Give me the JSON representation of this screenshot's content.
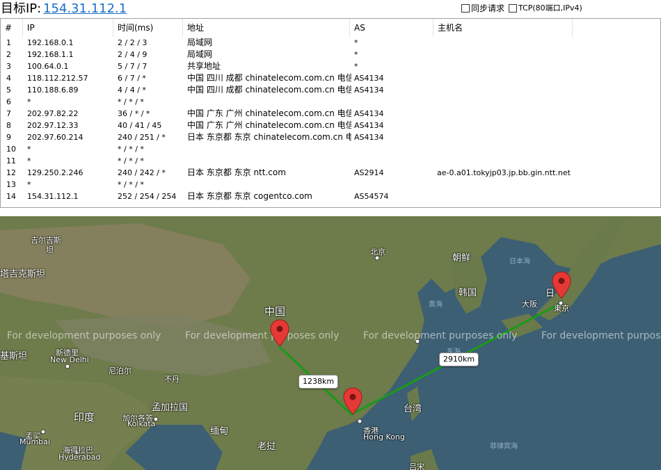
{
  "header": {
    "target_label": "目标IP:",
    "target_ip": "154.31.112.1",
    "sync_label": "同步请求",
    "tcp_label": "TCP(80端口,IPv4)"
  },
  "table": {
    "columns": [
      "#",
      "IP",
      "时间(ms)",
      "地址",
      "AS",
      "主机名"
    ],
    "rows": [
      {
        "n": "1",
        "ip": "192.168.0.1",
        "time": "2 / 2 / 3",
        "addr": "局域网",
        "as": "*",
        "host": ""
      },
      {
        "n": "2",
        "ip": "192.168.1.1",
        "time": "2 / 4 / 9",
        "addr": "局域网",
        "as": "*",
        "host": ""
      },
      {
        "n": "3",
        "ip": "100.64.0.1",
        "time": "5 / 7 / 7",
        "addr": "共享地址",
        "as": "*",
        "host": ""
      },
      {
        "n": "4",
        "ip": "118.112.212.57",
        "time": "6 / 7 / *",
        "addr": "中国 四川 成都 chinatelecom.com.cn 电信",
        "as": "AS4134",
        "host": ""
      },
      {
        "n": "5",
        "ip": "110.188.6.89",
        "time": "4 / 4 / *",
        "addr": "中国 四川 成都 chinatelecom.com.cn 电信",
        "as": "AS4134",
        "host": ""
      },
      {
        "n": "6",
        "ip": "*",
        "time": "* / * / *",
        "addr": "",
        "as": "",
        "host": ""
      },
      {
        "n": "7",
        "ip": "202.97.82.22",
        "time": "36 / * / *",
        "addr": "中国 广东 广州 chinatelecom.com.cn 电信",
        "as": "AS4134",
        "host": ""
      },
      {
        "n": "8",
        "ip": "202.97.12.33",
        "time": "40 / 41 / 45",
        "addr": "中国 广东 广州 chinatelecom.com.cn 电信",
        "as": "AS4134",
        "host": ""
      },
      {
        "n": "9",
        "ip": "202.97.60.214",
        "time": "240 / 251 / *",
        "addr": "日本 东京都 东京 chinatelecom.com.cn 电信",
        "as": "AS4134",
        "host": ""
      },
      {
        "n": "10",
        "ip": "*",
        "time": "* / * / *",
        "addr": "",
        "as": "",
        "host": ""
      },
      {
        "n": "11",
        "ip": "*",
        "time": "* / * / *",
        "addr": "",
        "as": "",
        "host": ""
      },
      {
        "n": "12",
        "ip": "129.250.2.246",
        "time": "240 / 242 / *",
        "addr": "日本 东京都 东京 ntt.com",
        "as": "AS2914",
        "host": "ae-0.a01.tokyjp03.jp.bb.gin.ntt.net"
      },
      {
        "n": "13",
        "ip": "*",
        "time": "* / * / *",
        "addr": "",
        "as": "",
        "host": ""
      },
      {
        "n": "14",
        "ip": "154.31.112.1",
        "time": "252 / 254 / 254",
        "addr": "日本 东京都 东京 cogentco.com",
        "as": "AS54574",
        "host": ""
      }
    ]
  },
  "map": {
    "watermark": "For development purposes only",
    "distances": [
      "1238km",
      "2910km"
    ],
    "labels": {
      "kyrgyz": "吉尔吉斯",
      "kyrgyz_en": "坦",
      "kazakh_stan": "塔吉克斯坦",
      "china": "中国",
      "beijing": "北京",
      "korea_n": "朝鲜",
      "korea_s": "韩国",
      "japan_sea": "日本海",
      "japan": "日",
      "osaka": "大阪",
      "tokyo": "東京",
      "yellow_sea": "黄海",
      "east_sea": "东海",
      "pakistan": "基斯坦",
      "new_delhi_cn": "新德里",
      "new_delhi": "New Delhi",
      "nepal": "尼泊尔",
      "bhutan": "不丹",
      "bangladesh": "孟加拉国",
      "kolkata_cn": "加尔各答",
      "kolkata": "Kolkata",
      "india": "印度",
      "mumbai_cn": "孟买",
      "mumbai": "Mumbai",
      "hyderabad_cn": "海得拉巴",
      "hyderabad": "Hyderabad",
      "myanmar": "缅甸",
      "laos": "老挝",
      "hongkong_cn": "香港",
      "hongkong": "Hong Kong",
      "taiwan": "台湾",
      "philippine_sea": "菲律宾海",
      "luzon": "吕宋"
    },
    "colors": {
      "route": "#1a9a1a",
      "pin": "#e53935",
      "sea": "#3d5f74",
      "land": "#6b7a4a"
    }
  }
}
